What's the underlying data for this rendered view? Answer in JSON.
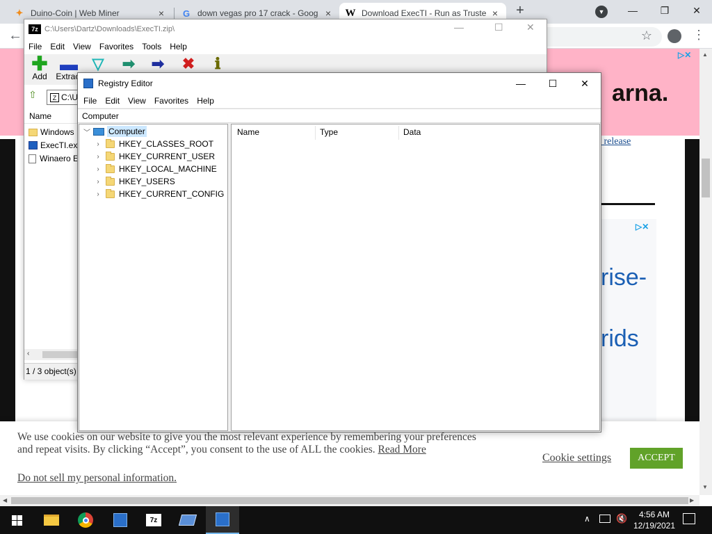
{
  "browser": {
    "tabs": [
      {
        "title": "Duino-Coin | Web Miner",
        "icon": "duino-icon",
        "close": "×"
      },
      {
        "title": "down vegas pro 17 crack - Goog",
        "icon": "google-icon",
        "close": "×"
      },
      {
        "title": "Download ExecTI - Run as Truste",
        "icon": "w-icon",
        "close": "×"
      }
    ],
    "new_tab": "+",
    "window_controls": {
      "minimize": "—",
      "maximize": "❐",
      "close": "✕"
    }
  },
  "page": {
    "ad_brand": "arna.",
    "link_text": "0 release",
    "ad2_line1": "rise-",
    "ad2_line2": "rids",
    "cookie": {
      "text": "We use cookies on our website to give you the most relevant experience by remembering your preferences and repeat visits. By clicking “Accept”, you consent to the use of ALL the cookies.",
      "read_more": "Read More",
      "do_not_sell": "Do not sell my personal information",
      "settings": "Cookie settings",
      "accept": "ACCEPT"
    }
  },
  "zip": {
    "title": "C:\\Users\\Dartz\\Downloads\\ExecTI.zip\\",
    "menu": [
      "File",
      "Edit",
      "View",
      "Favorites",
      "Tools",
      "Help"
    ],
    "tools": [
      {
        "label": "Add",
        "icon": "plus-icon",
        "color": "#1fa51f"
      },
      {
        "label": "Extract",
        "icon": "minus-icon",
        "color": "#1f3fbf"
      },
      {
        "label": "",
        "icon": "test-icon",
        "color": "#1fb7b7"
      },
      {
        "label": "",
        "icon": "copy-icon",
        "color": "#1f8f6f"
      },
      {
        "label": "",
        "icon": "move-icon",
        "color": "#1f2f9f"
      },
      {
        "label": "",
        "icon": "delete-icon",
        "color": "#d11f1f"
      },
      {
        "label": "",
        "icon": "info-icon",
        "color": "#6b6b00"
      }
    ],
    "addr_prefix": "C:\\U",
    "name_header": "Name",
    "files": [
      "Windows",
      "ExecTI.exe",
      "Winaero E"
    ],
    "status": "1 / 3 object(s)"
  },
  "regedit": {
    "title": "Registry Editor",
    "menu": [
      "File",
      "Edit",
      "View",
      "Favorites",
      "Help"
    ],
    "address": "Computer",
    "root": "Computer",
    "keys": [
      "HKEY_CLASSES_ROOT",
      "HKEY_CURRENT_USER",
      "HKEY_LOCAL_MACHINE",
      "HKEY_USERS",
      "HKEY_CURRENT_CONFIG"
    ],
    "columns": [
      "Name",
      "Type",
      "Data"
    ]
  },
  "taskbar": {
    "time": "4:56 AM",
    "date": "12/19/2021"
  }
}
